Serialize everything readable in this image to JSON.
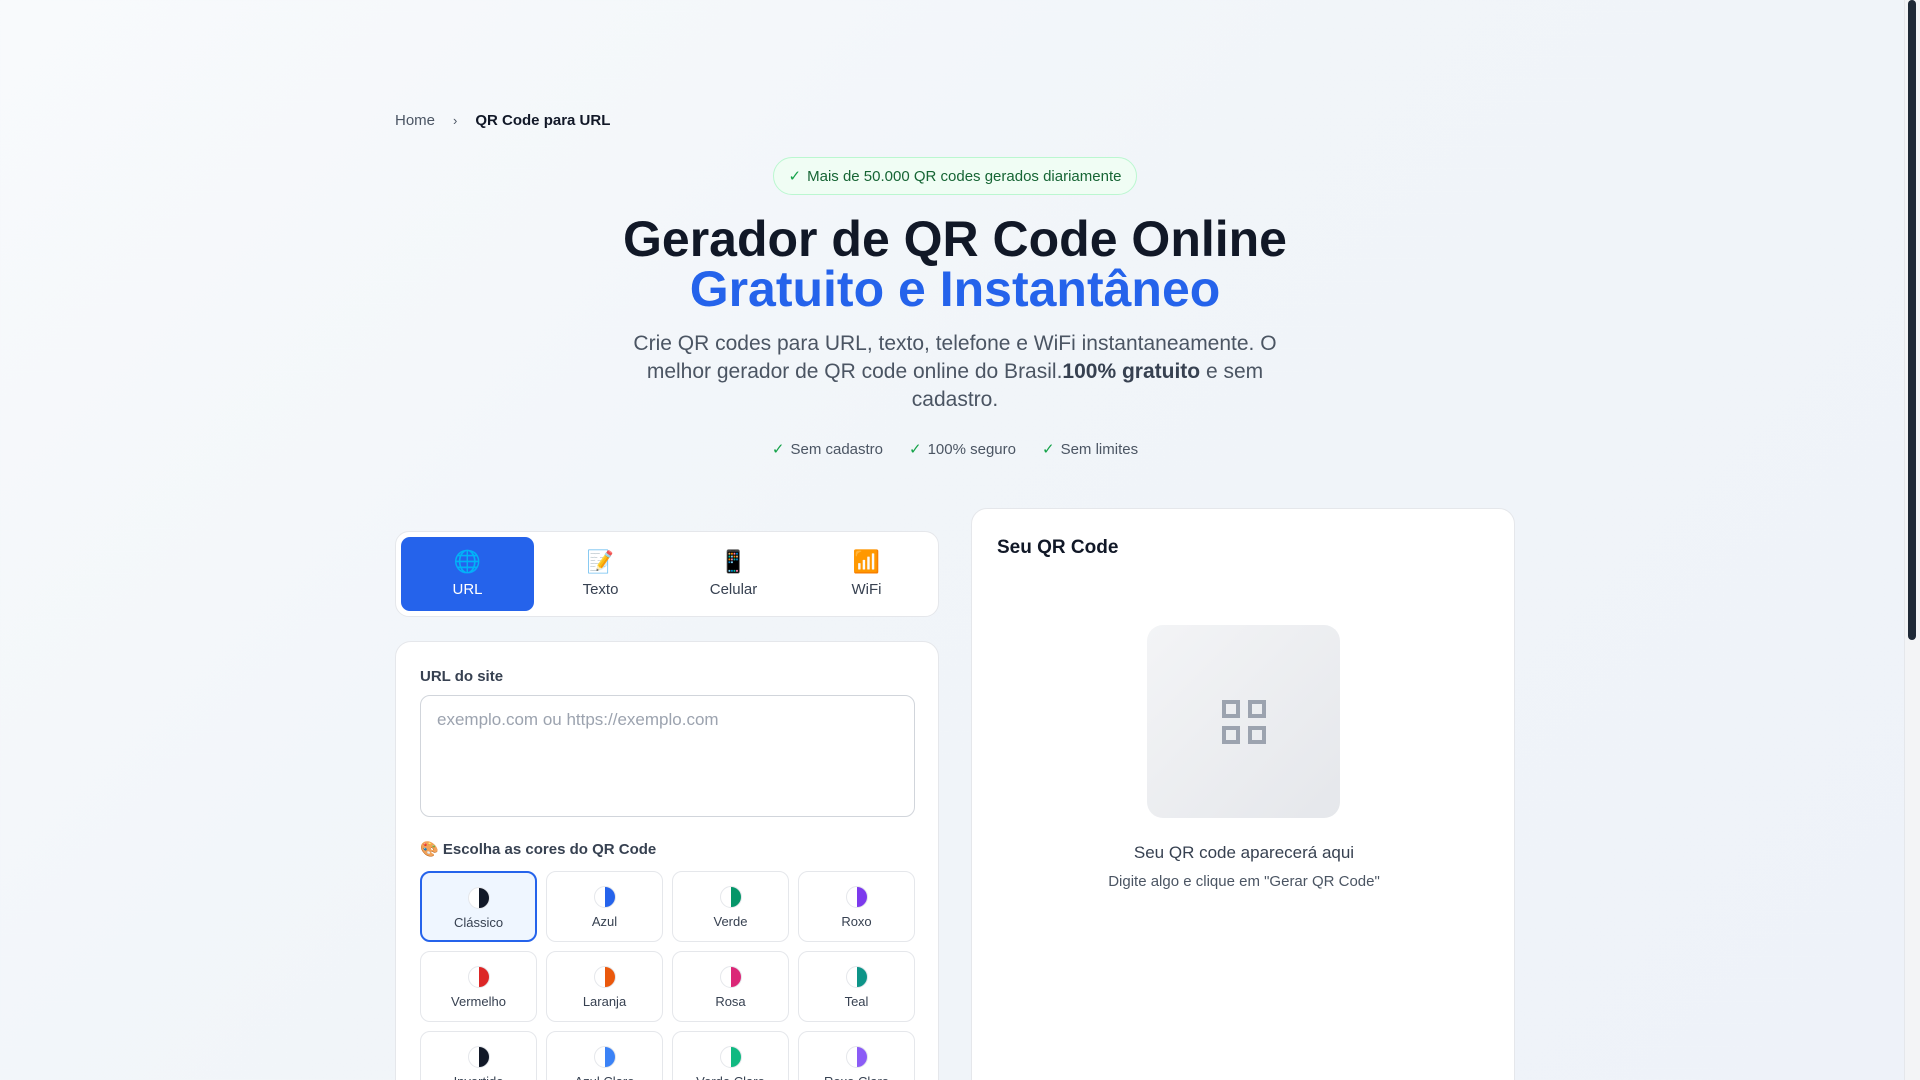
{
  "breadcrumb": {
    "home": "Home",
    "separator": "›",
    "current": "QR Code para URL"
  },
  "badge": {
    "text": "Mais de 50.000 QR codes gerados diariamente"
  },
  "hero": {
    "title_line1": "Gerador de QR Code Online",
    "title_line2": "Gratuito e Instantâneo",
    "desc_part1": "Crie QR codes para URL, texto, telefone e WiFi instantaneamente. O melhor gerador de QR code online do Brasil.",
    "desc_bold": "100% gratuito",
    "desc_part2": " e sem cadastro."
  },
  "features": [
    "Sem cadastro",
    "100% seguro",
    "Sem limites"
  ],
  "tabs": [
    {
      "icon": "🌐",
      "label": "URL",
      "active": true
    },
    {
      "icon": "📝",
      "label": "Texto",
      "active": false
    },
    {
      "icon": "📱",
      "label": "Celular",
      "active": false
    },
    {
      "icon": "📶",
      "label": "WiFi",
      "active": false
    }
  ],
  "form": {
    "url_label": "URL do site",
    "url_placeholder": "exemplo.com ou https://exemplo.com",
    "url_value": "",
    "colors_label": "🎨 Escolha as cores do QR Code"
  },
  "color_options": [
    {
      "label": "Clássico",
      "color": "#111827",
      "selected": true
    },
    {
      "label": "Azul",
      "color": "#2563eb",
      "selected": false
    },
    {
      "label": "Verde",
      "color": "#059669",
      "selected": false
    },
    {
      "label": "Roxo",
      "color": "#7c3aed",
      "selected": false
    },
    {
      "label": "Vermelho",
      "color": "#dc2626",
      "selected": false
    },
    {
      "label": "Laranja",
      "color": "#ea580c",
      "selected": false
    },
    {
      "label": "Rosa",
      "color": "#db2777",
      "selected": false
    },
    {
      "label": "Teal",
      "color": "#0d9488",
      "selected": false
    },
    {
      "label": "Invertido",
      "color": "#111827",
      "selected": false
    },
    {
      "label": "Azul Claro",
      "color": "#3b82f6",
      "selected": false
    },
    {
      "label": "Verde Claro",
      "color": "#10b981",
      "selected": false
    },
    {
      "label": "Roxo Claro",
      "color": "#8b5cf6",
      "selected": false
    }
  ],
  "preview": {
    "title": "Seu QR Code",
    "empty_main": "Seu QR code aparecerá aqui",
    "empty_sub": "Digite algo e clique em \"Gerar QR Code\""
  },
  "colors": {
    "accent": "#2563eb",
    "success": "#16a34a"
  }
}
